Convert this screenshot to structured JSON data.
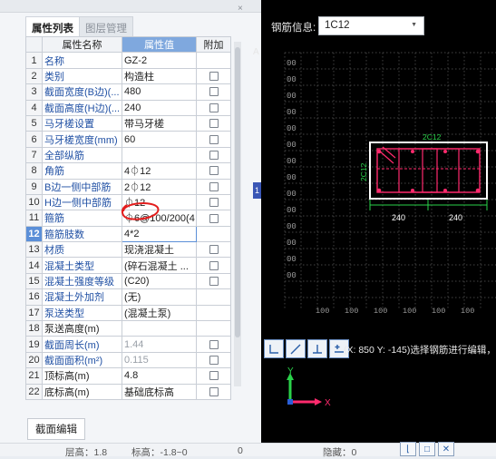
{
  "tabs": [
    {
      "label": "属性列表",
      "active": true
    },
    {
      "label": "图层管理",
      "active": false
    }
  ],
  "table": {
    "headers": {
      "name": "属性名称",
      "value": "属性值",
      "extra": "附加"
    },
    "rows": [
      {
        "num": "1",
        "name": "名称",
        "value": "GZ-2",
        "checkbox": false
      },
      {
        "num": "2",
        "name": "类别",
        "value": "构造柱",
        "checkbox": true
      },
      {
        "num": "3",
        "name": "截面宽度(B边)(...",
        "value": "480",
        "checkbox": true
      },
      {
        "num": "4",
        "name": "截面高度(H边)(...",
        "value": "240",
        "checkbox": true
      },
      {
        "num": "5",
        "name": "马牙槎设置",
        "value": "带马牙槎",
        "checkbox": true
      },
      {
        "num": "6",
        "name": "马牙槎宽度(mm)",
        "value": "60",
        "checkbox": true
      },
      {
        "num": "7",
        "name": "全部纵筋",
        "value": "",
        "checkbox": true
      },
      {
        "num": "8",
        "name": "角筋",
        "value": "4⏀12",
        "checkbox": true
      },
      {
        "num": "9",
        "name": "B边一侧中部筋",
        "value": "2⏀12",
        "checkbox": true
      },
      {
        "num": "10",
        "name": "H边一侧中部筋",
        "value": "⏀12",
        "checkbox": true
      },
      {
        "num": "11",
        "name": "箍筋",
        "value": "⏀6@100/200(4",
        "checkbox": true
      },
      {
        "num": "12",
        "name": "箍筋肢数",
        "value": "4*2",
        "checkbox": false,
        "selected": true
      },
      {
        "num": "13",
        "name": "材质",
        "value": "现浇混凝土",
        "checkbox": true
      },
      {
        "num": "14",
        "name": "混凝土类型",
        "value": "(碎石混凝土 ...",
        "checkbox": true
      },
      {
        "num": "15",
        "name": "混凝土强度等级",
        "value": "(C20)",
        "checkbox": true
      },
      {
        "num": "16",
        "name": "混凝土外加剂",
        "value": "(无)",
        "checkbox": false
      },
      {
        "num": "17",
        "name": "泵送类型",
        "value": "(混凝土泵)",
        "checkbox": false
      },
      {
        "num": "18",
        "name": "泵送高度(m)",
        "value": "",
        "checkbox": false,
        "plain": true
      },
      {
        "num": "19",
        "name": "截面周长(m)",
        "value": "1.44",
        "checkbox": true,
        "grey": true
      },
      {
        "num": "20",
        "name": "截面面积(m²)",
        "value": "0.115",
        "checkbox": true,
        "grey": true
      },
      {
        "num": "21",
        "name": "顶标高(m)",
        "value": "4.8",
        "checkbox": true,
        "plain": true
      },
      {
        "num": "22",
        "name": "底标高(m)",
        "value": "基础底标高",
        "checkbox": true,
        "plain": true
      }
    ]
  },
  "edit_button": "截面编辑",
  "status": {
    "floor_height": "层高：1.8",
    "elevation": "标高：-1.8~0",
    "zero": "0",
    "hidden": "隐藏：0"
  },
  "editor": {
    "rebar_label": "钢筋信息:",
    "rebar_value": "1C12",
    "dim_left": "240",
    "dim_right": "240",
    "top_rebar": "2C12",
    "side_rebar": "2C12",
    "grid_label": "00",
    "bottom_ticks": [
      "100",
      "100",
      "100",
      "100",
      "100",
      "100"
    ],
    "coord_text": "(X: 850 Y: -145)选择钢筋进行编辑，",
    "axis_x": "X",
    "axis_y": "Y"
  },
  "colors": {
    "section_outline": "#ffffff",
    "rebar": "#ff2a6d",
    "dim_green": "#2ad24a",
    "grid": "#5a5a5a",
    "annotation_red": "#e31d1d"
  }
}
